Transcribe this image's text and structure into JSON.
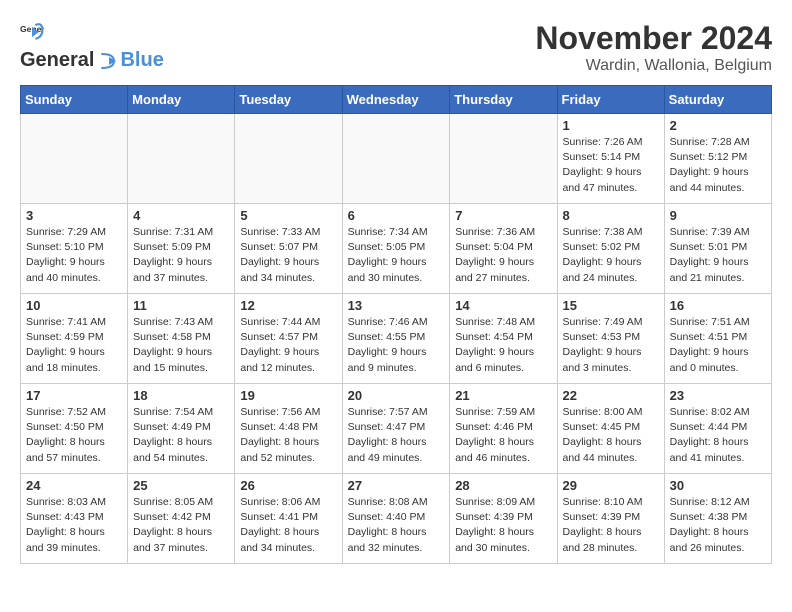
{
  "header": {
    "logo_general": "General",
    "logo_blue": "Blue",
    "month": "November 2024",
    "location": "Wardin, Wallonia, Belgium"
  },
  "weekdays": [
    "Sunday",
    "Monday",
    "Tuesday",
    "Wednesday",
    "Thursday",
    "Friday",
    "Saturday"
  ],
  "weeks": [
    [
      {
        "day": "",
        "info": ""
      },
      {
        "day": "",
        "info": ""
      },
      {
        "day": "",
        "info": ""
      },
      {
        "day": "",
        "info": ""
      },
      {
        "day": "",
        "info": ""
      },
      {
        "day": "1",
        "info": "Sunrise: 7:26 AM\nSunset: 5:14 PM\nDaylight: 9 hours\nand 47 minutes."
      },
      {
        "day": "2",
        "info": "Sunrise: 7:28 AM\nSunset: 5:12 PM\nDaylight: 9 hours\nand 44 minutes."
      }
    ],
    [
      {
        "day": "3",
        "info": "Sunrise: 7:29 AM\nSunset: 5:10 PM\nDaylight: 9 hours\nand 40 minutes."
      },
      {
        "day": "4",
        "info": "Sunrise: 7:31 AM\nSunset: 5:09 PM\nDaylight: 9 hours\nand 37 minutes."
      },
      {
        "day": "5",
        "info": "Sunrise: 7:33 AM\nSunset: 5:07 PM\nDaylight: 9 hours\nand 34 minutes."
      },
      {
        "day": "6",
        "info": "Sunrise: 7:34 AM\nSunset: 5:05 PM\nDaylight: 9 hours\nand 30 minutes."
      },
      {
        "day": "7",
        "info": "Sunrise: 7:36 AM\nSunset: 5:04 PM\nDaylight: 9 hours\nand 27 minutes."
      },
      {
        "day": "8",
        "info": "Sunrise: 7:38 AM\nSunset: 5:02 PM\nDaylight: 9 hours\nand 24 minutes."
      },
      {
        "day": "9",
        "info": "Sunrise: 7:39 AM\nSunset: 5:01 PM\nDaylight: 9 hours\nand 21 minutes."
      }
    ],
    [
      {
        "day": "10",
        "info": "Sunrise: 7:41 AM\nSunset: 4:59 PM\nDaylight: 9 hours\nand 18 minutes."
      },
      {
        "day": "11",
        "info": "Sunrise: 7:43 AM\nSunset: 4:58 PM\nDaylight: 9 hours\nand 15 minutes."
      },
      {
        "day": "12",
        "info": "Sunrise: 7:44 AM\nSunset: 4:57 PM\nDaylight: 9 hours\nand 12 minutes."
      },
      {
        "day": "13",
        "info": "Sunrise: 7:46 AM\nSunset: 4:55 PM\nDaylight: 9 hours\nand 9 minutes."
      },
      {
        "day": "14",
        "info": "Sunrise: 7:48 AM\nSunset: 4:54 PM\nDaylight: 9 hours\nand 6 minutes."
      },
      {
        "day": "15",
        "info": "Sunrise: 7:49 AM\nSunset: 4:53 PM\nDaylight: 9 hours\nand 3 minutes."
      },
      {
        "day": "16",
        "info": "Sunrise: 7:51 AM\nSunset: 4:51 PM\nDaylight: 9 hours\nand 0 minutes."
      }
    ],
    [
      {
        "day": "17",
        "info": "Sunrise: 7:52 AM\nSunset: 4:50 PM\nDaylight: 8 hours\nand 57 minutes."
      },
      {
        "day": "18",
        "info": "Sunrise: 7:54 AM\nSunset: 4:49 PM\nDaylight: 8 hours\nand 54 minutes."
      },
      {
        "day": "19",
        "info": "Sunrise: 7:56 AM\nSunset: 4:48 PM\nDaylight: 8 hours\nand 52 minutes."
      },
      {
        "day": "20",
        "info": "Sunrise: 7:57 AM\nSunset: 4:47 PM\nDaylight: 8 hours\nand 49 minutes."
      },
      {
        "day": "21",
        "info": "Sunrise: 7:59 AM\nSunset: 4:46 PM\nDaylight: 8 hours\nand 46 minutes."
      },
      {
        "day": "22",
        "info": "Sunrise: 8:00 AM\nSunset: 4:45 PM\nDaylight: 8 hours\nand 44 minutes."
      },
      {
        "day": "23",
        "info": "Sunrise: 8:02 AM\nSunset: 4:44 PM\nDaylight: 8 hours\nand 41 minutes."
      }
    ],
    [
      {
        "day": "24",
        "info": "Sunrise: 8:03 AM\nSunset: 4:43 PM\nDaylight: 8 hours\nand 39 minutes."
      },
      {
        "day": "25",
        "info": "Sunrise: 8:05 AM\nSunset: 4:42 PM\nDaylight: 8 hours\nand 37 minutes."
      },
      {
        "day": "26",
        "info": "Sunrise: 8:06 AM\nSunset: 4:41 PM\nDaylight: 8 hours\nand 34 minutes."
      },
      {
        "day": "27",
        "info": "Sunrise: 8:08 AM\nSunset: 4:40 PM\nDaylight: 8 hours\nand 32 minutes."
      },
      {
        "day": "28",
        "info": "Sunrise: 8:09 AM\nSunset: 4:39 PM\nDaylight: 8 hours\nand 30 minutes."
      },
      {
        "day": "29",
        "info": "Sunrise: 8:10 AM\nSunset: 4:39 PM\nDaylight: 8 hours\nand 28 minutes."
      },
      {
        "day": "30",
        "info": "Sunrise: 8:12 AM\nSunset: 4:38 PM\nDaylight: 8 hours\nand 26 minutes."
      }
    ]
  ]
}
